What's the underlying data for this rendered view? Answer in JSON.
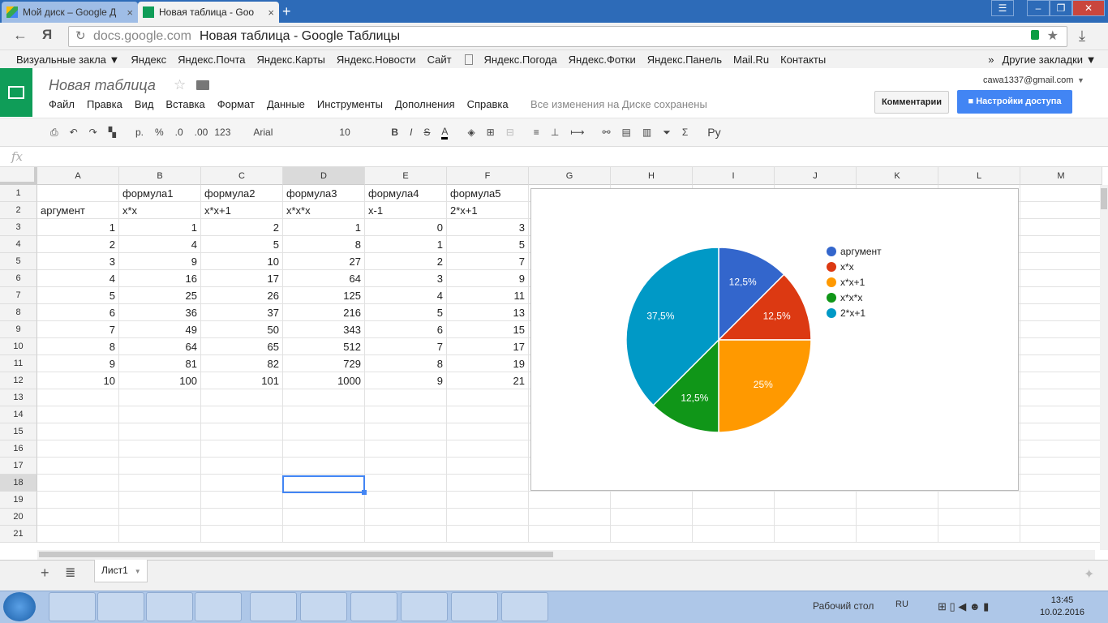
{
  "browser": {
    "tabs": [
      {
        "label": "Мой диск – Google Д",
        "active": false
      },
      {
        "label": "Новая таблица - Goo",
        "active": true
      }
    ],
    "url_domain": "docs.google.com",
    "url_title": "Новая таблица - Google Таблицы",
    "bookmarks": [
      "Визуальные закла ▼",
      "Яндекс",
      "Яндекс.Почта",
      "Яндекс.Карты",
      "Яндекс.Новости",
      "Сайт",
      "Яндекс.Погода",
      "Яндекс.Фотки",
      "Яндекс.Панель",
      "Mail.Ru",
      "Контакты"
    ],
    "other_bookmarks": "Другие закладки ▼"
  },
  "sheets": {
    "doc_title": "Новая таблица",
    "menu": [
      "Файл",
      "Правка",
      "Вид",
      "Вставка",
      "Формат",
      "Данные",
      "Инструменты",
      "Дополнения",
      "Справка"
    ],
    "save_status": "Все изменения на Диске сохранены",
    "account": "cawa1337@gmail.com",
    "comments_label": "Комментарии",
    "share_label": "Настройки доступа",
    "toolbar": {
      "currency": "р.",
      "percent": "%",
      "dec_less": ".0",
      "dec_more": ".00",
      "format_more": "123",
      "font": "Arial",
      "font_size": "10",
      "bold": "B",
      "italic": "I",
      "strike": "S",
      "text_color": "A",
      "input_tools": "Ру"
    },
    "fx_label": "fx",
    "columns": [
      "A",
      "B",
      "C",
      "D",
      "E",
      "F",
      "G",
      "H",
      "I",
      "J",
      "K",
      "L",
      "M"
    ],
    "row_numbers": [
      "1",
      "2",
      "3",
      "4",
      "5",
      "6",
      "7",
      "8",
      "9",
      "10",
      "11",
      "12",
      "13",
      "14",
      "15",
      "16",
      "17",
      "18",
      "19",
      "20",
      "21"
    ],
    "header_row1": [
      "",
      "формула1",
      "формула2",
      "формула3",
      "формула4",
      "формула5"
    ],
    "header_row2": [
      "аргумент",
      "x*x",
      "x*x+1",
      "x*x*x",
      "x-1",
      "2*x+1"
    ],
    "data_rows": [
      [
        "1",
        "1",
        "2",
        "1",
        "0",
        "3"
      ],
      [
        "2",
        "4",
        "5",
        "8",
        "1",
        "5"
      ],
      [
        "3",
        "9",
        "10",
        "27",
        "2",
        "7"
      ],
      [
        "4",
        "16",
        "17",
        "64",
        "3",
        "9"
      ],
      [
        "5",
        "25",
        "26",
        "125",
        "4",
        "11"
      ],
      [
        "6",
        "36",
        "37",
        "216",
        "5",
        "13"
      ],
      [
        "7",
        "49",
        "50",
        "343",
        "6",
        "15"
      ],
      [
        "8",
        "64",
        "65",
        "512",
        "7",
        "17"
      ],
      [
        "9",
        "81",
        "82",
        "729",
        "8",
        "19"
      ],
      [
        "10",
        "100",
        "101",
        "1000",
        "9",
        "21"
      ]
    ],
    "sheet_tab": "Лист1"
  },
  "chart_data": {
    "type": "pie",
    "slices": [
      {
        "name": "аргумент",
        "value": 12.5,
        "label": "12,5%",
        "color": "#3366cc"
      },
      {
        "name": "x*x",
        "value": 12.5,
        "label": "12,5%",
        "color": "#dc3912"
      },
      {
        "name": "x*x+1",
        "value": 25,
        "label": "25%",
        "color": "#ff9900"
      },
      {
        "name": "x*x*x",
        "value": 12.5,
        "label": "12,5%",
        "color": "#109618"
      },
      {
        "name": "2*x+1",
        "value": 37.5,
        "label": "37,5%",
        "color": "#0099c6"
      }
    ],
    "legend_position": "right"
  },
  "taskbar": {
    "desktop_label": "Рабочий стол",
    "lang": "RU",
    "time": "13:45",
    "date": "10.02.2016"
  }
}
